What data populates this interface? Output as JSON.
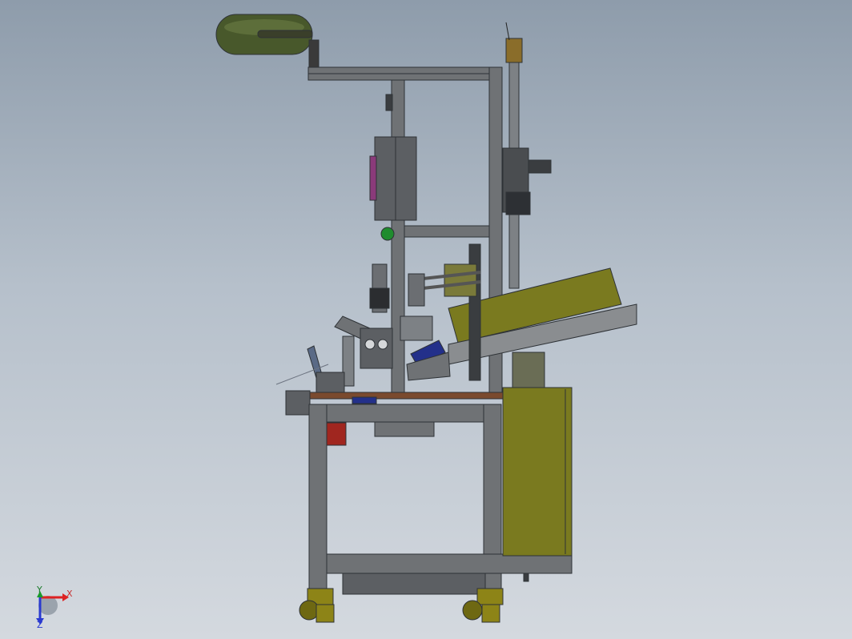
{
  "triad": {
    "x_label": "X",
    "y_label": "Y",
    "z_label": "Z"
  },
  "colors": {
    "frame": "#6f7275",
    "frame_edge": "#2e3236",
    "olive": "#7a7a1f",
    "olive_dark": "#55551a",
    "tank_green": "#48582b",
    "navy": "#23308a",
    "red": "#a0261f",
    "wood": "#7a4a2e",
    "caster": "#8d8417",
    "background_top": "#8e9cab",
    "background_bottom": "#d4d9df"
  },
  "icons": [
    "coordinate-triad-icon"
  ]
}
